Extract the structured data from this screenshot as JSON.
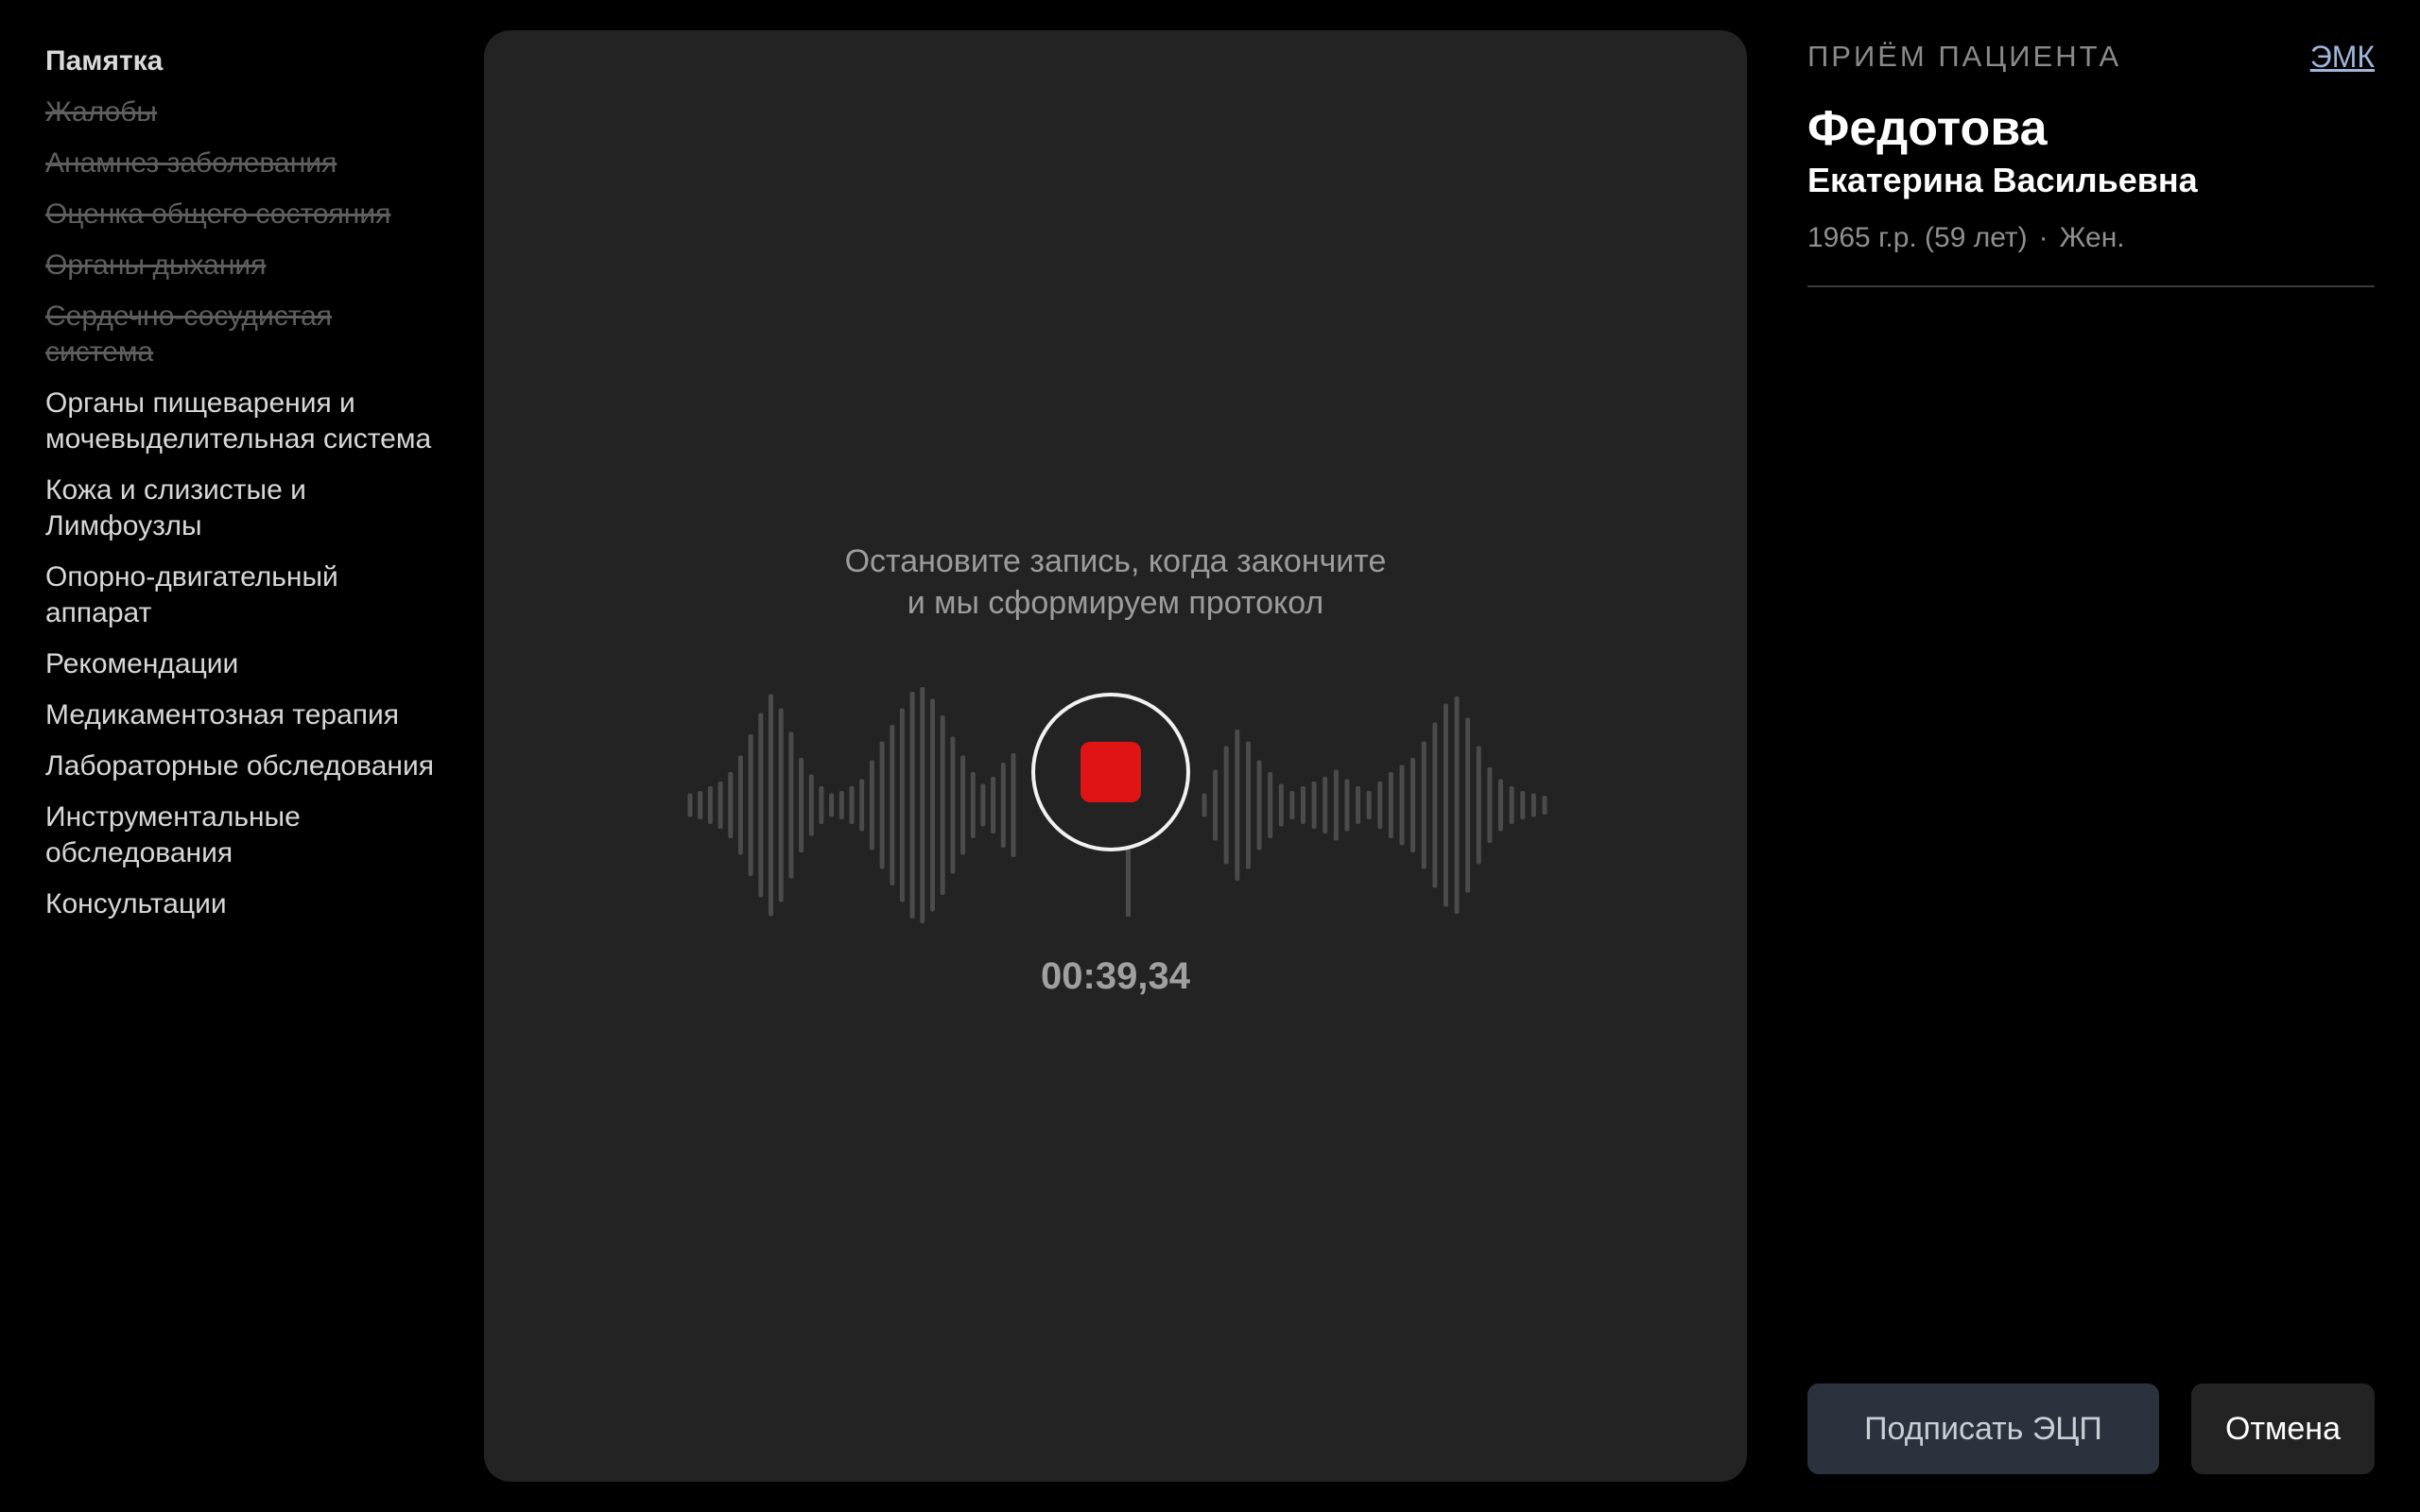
{
  "sidebar": {
    "heading": "Памятка",
    "items": [
      {
        "label": "Жалобы",
        "done": true
      },
      {
        "label": "Анамнез заболевания",
        "done": true
      },
      {
        "label": "Оценка общего состояния",
        "done": true
      },
      {
        "label": "Органы дыхания",
        "done": true
      },
      {
        "label": "Сердечно-сосудистая система",
        "done": true
      },
      {
        "label": "Органы пищеварения и мочевыделительная система",
        "done": false
      },
      {
        "label": "Кожа и слизистые и Лимфоузлы",
        "done": false
      },
      {
        "label": "Опорно-двигательный аппарат",
        "done": false
      },
      {
        "label": "Рекомендации",
        "done": false
      },
      {
        "label": "Медикаментозная терапия",
        "done": false
      },
      {
        "label": "Лабораторные обследования",
        "done": false
      },
      {
        "label": "Инструментальные обследования",
        "done": false
      },
      {
        "label": "Консультации",
        "done": false
      }
    ]
  },
  "recorder": {
    "hint_line1": "Остановите запись, когда закончите",
    "hint_line2": "и мы сформируем протокол",
    "timer": "00:39,34",
    "stop_color": "#e01414",
    "waveform_levels": [
      0.1,
      0.12,
      0.16,
      0.2,
      0.28,
      0.42,
      0.6,
      0.78,
      0.94,
      0.82,
      0.62,
      0.4,
      0.26,
      0.16,
      0.1,
      0.12,
      0.16,
      0.22,
      0.38,
      0.54,
      0.68,
      0.82,
      0.96,
      1.0,
      0.9,
      0.76,
      0.58,
      0.42,
      0.28,
      0.18,
      0.24,
      0.36,
      0.44,
      0.1,
      0.3,
      0.5,
      0.64,
      0.54,
      0.38,
      0.28,
      0.18,
      0.12,
      0.16,
      0.2,
      0.24,
      0.3,
      0.22,
      0.16,
      0.12,
      0.2,
      0.28,
      0.34,
      0.4,
      0.54,
      0.7,
      0.86,
      0.92,
      0.74,
      0.5,
      0.32,
      0.22,
      0.16,
      0.12,
      0.1,
      0.08
    ]
  },
  "patient": {
    "section_title": "ПРИЁМ ПАЦИЕНТА",
    "emk_link": "ЭМК",
    "surname": "Федотова",
    "given_names": "Екатерина Васильевна",
    "birth_info": "1965 г.р. (59 лет)",
    "separator": "·",
    "sex": "Жен."
  },
  "actions": {
    "sign_label": "Подписать ЭЦП",
    "cancel_label": "Отмена"
  },
  "colors": {
    "background": "#000000",
    "panel": "#232323",
    "accent_link": "#9fb4d8",
    "sign_button": "#2b323d"
  }
}
